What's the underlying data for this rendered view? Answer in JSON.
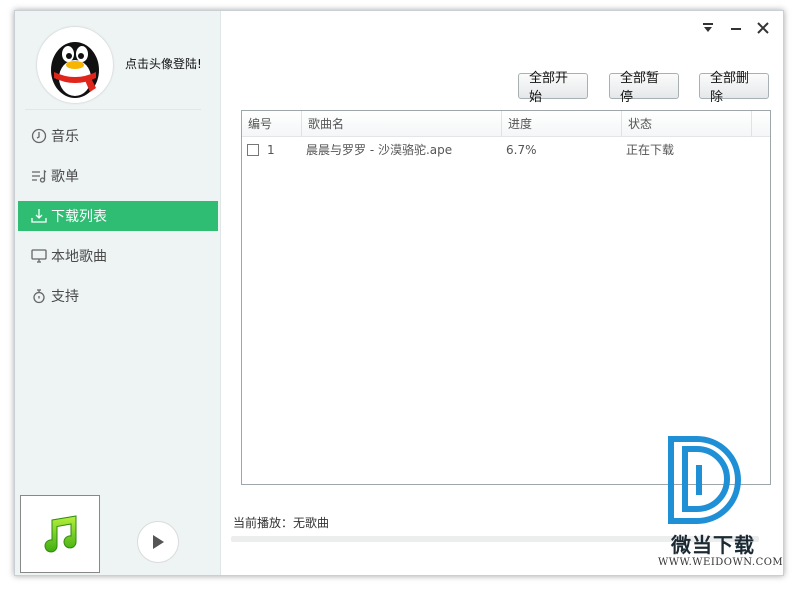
{
  "sidebar": {
    "login_text": "点击头像登陆!",
    "items": [
      {
        "label": "音乐",
        "icon": "music-disc-icon",
        "active": false
      },
      {
        "label": "歌单",
        "icon": "playlist-icon",
        "active": false
      },
      {
        "label": "下载列表",
        "icon": "download-tray-icon",
        "active": true
      },
      {
        "label": "本地歌曲",
        "icon": "monitor-icon",
        "active": false
      },
      {
        "label": "支持",
        "icon": "support-icon",
        "active": false
      }
    ]
  },
  "toolbar": {
    "start_all": "全部开始",
    "pause_all": "全部暂停",
    "delete_all": "全部删除"
  },
  "table": {
    "columns": [
      "编号",
      "歌曲名",
      "进度",
      "状态"
    ],
    "rows": [
      {
        "index": "1",
        "name": "晨晨与罗罗 - 沙漠骆驼.ape",
        "progress": "6.7%",
        "status": "正在下载"
      }
    ]
  },
  "player": {
    "now_playing": "当前播放：无歌曲"
  },
  "watermark": {
    "brand": "微当下载",
    "url": "WWW.WEIDOWN.COM"
  },
  "colors": {
    "accent": "#2ebd73",
    "sidebar_bg": "#eef4f4",
    "watermark_blue": "#1f8fd6"
  }
}
